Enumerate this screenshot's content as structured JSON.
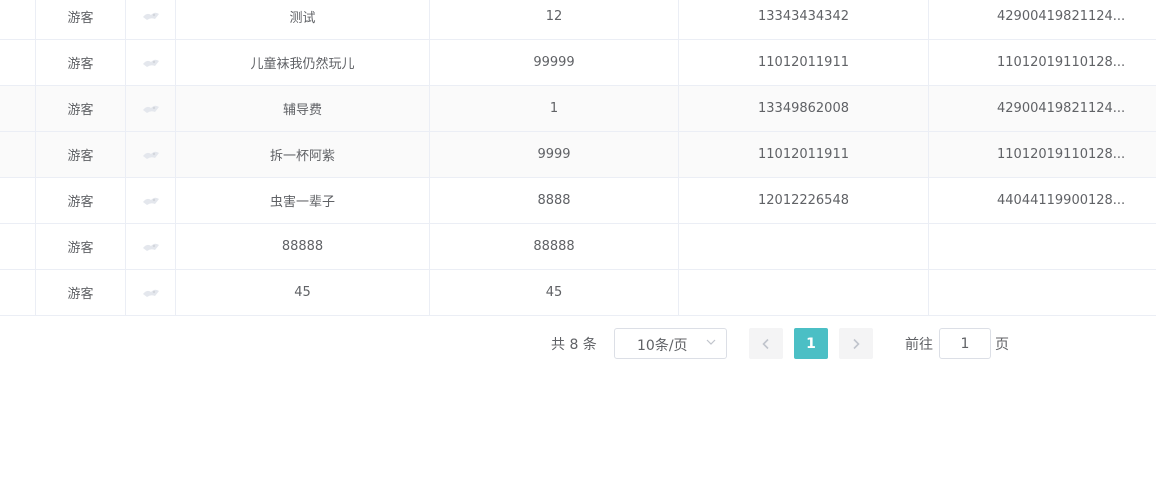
{
  "table": {
    "rows": [
      {
        "role": "游客",
        "name": "测试",
        "count": "12",
        "phone": "13343434342",
        "idcard": "42900419821124..."
      },
      {
        "role": "游客",
        "name": "儿童袜我仍然玩儿",
        "count": "99999",
        "phone": "11012011911",
        "idcard": "11012019110128..."
      },
      {
        "role": "游客",
        "name": "辅导费",
        "count": "1",
        "phone": "13349862008",
        "idcard": "42900419821124..."
      },
      {
        "role": "游客",
        "name": "拆一杯阿紫",
        "count": "9999",
        "phone": "11012011911",
        "idcard": "11012019110128..."
      },
      {
        "role": "游客",
        "name": "虫害一辈子",
        "count": "8888",
        "phone": "12012226548",
        "idcard": "44044119900128..."
      },
      {
        "role": "游客",
        "name": "88888",
        "count": "88888",
        "phone": "",
        "idcard": ""
      },
      {
        "role": "游客",
        "name": "45",
        "count": "45",
        "phone": "",
        "idcard": ""
      }
    ]
  },
  "pagination": {
    "total_label": "共 8 条",
    "page_size": "10条/页",
    "current_page": "1",
    "goto_label": "前往",
    "goto_value": "1",
    "goto_suffix": "页",
    "accent_color": "#4bbfc5"
  }
}
